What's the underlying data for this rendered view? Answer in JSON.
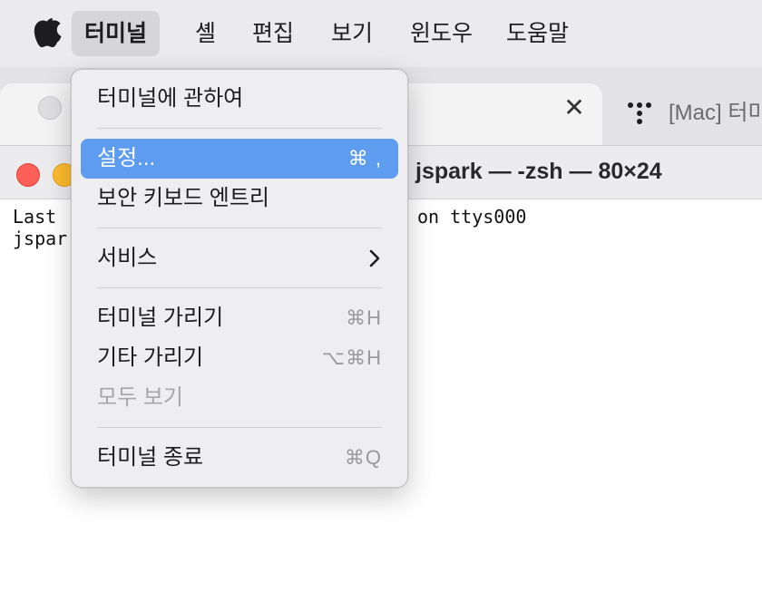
{
  "menubar": {
    "apple_icon": "apple-icon",
    "items": [
      "터미널",
      "셸",
      "편집",
      "보기",
      "윈도우",
      "도움말"
    ],
    "active_index": 0
  },
  "tabs": {
    "right_tab_title": "[Mac] 터미",
    "right_tab_icon": "terminal-dots-icon",
    "close_glyph": "✕"
  },
  "window": {
    "title": "jspark — -zsh — 80×24",
    "terminal_line1_left": "Last",
    "terminal_line1_right": "on ttys000",
    "terminal_line2_left": "jspar"
  },
  "dropdown": {
    "items": [
      {
        "label": "터미널에 관하여",
        "shortcut": ""
      },
      {
        "label": "설정...",
        "shortcut": "⌘ ,"
      },
      {
        "label": "보안 키보드 엔트리",
        "shortcut": ""
      },
      {
        "label": "서비스",
        "shortcut": ""
      },
      {
        "label": "터미널 가리기",
        "shortcut": "⌘H"
      },
      {
        "label": "기타 가리기",
        "shortcut": "⌥⌘H"
      },
      {
        "label": "모두 보기",
        "shortcut": ""
      },
      {
        "label": "터미널 종료",
        "shortcut": "⌘Q"
      }
    ],
    "highlighted_index": 1,
    "disabled_index": 6
  },
  "colors": {
    "highlight": "#5e9cf0",
    "close": "#fe5f57",
    "minimize": "#febc2e"
  }
}
